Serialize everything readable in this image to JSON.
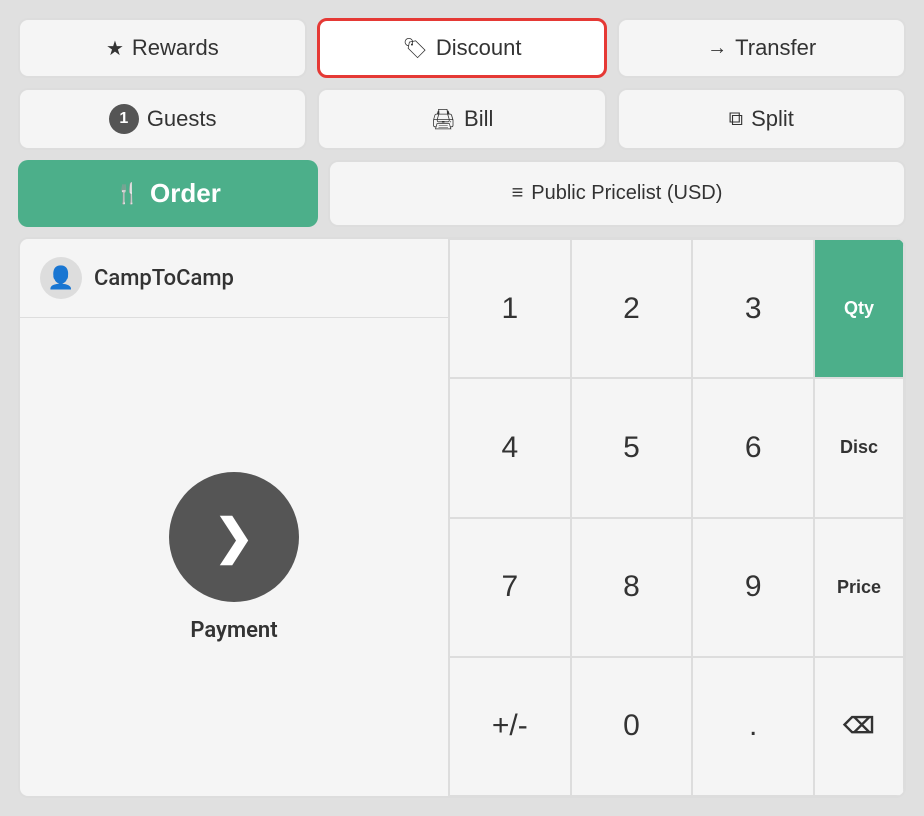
{
  "header": {
    "rewards_label": "Rewards",
    "discount_label": "Discount",
    "transfer_label": "Transfer",
    "guests_count": "1",
    "guests_label": "Guests",
    "bill_label": "Bill",
    "split_label": "Split",
    "order_label": "Order",
    "pricelist_label": "Public Pricelist (USD)"
  },
  "customer": {
    "name": "CampToCamp"
  },
  "payment": {
    "label": "Payment"
  },
  "numpad": {
    "keys": [
      "1",
      "2",
      "3",
      "4",
      "5",
      "6",
      "7",
      "8",
      "9",
      "+/-",
      "0",
      "."
    ],
    "side_keys": [
      "Qty",
      "Disc",
      "Price",
      "⌫"
    ]
  },
  "icons": {
    "rewards": "★",
    "discount": "🏷",
    "transfer": "→",
    "bill": "🖨",
    "split": "⧉",
    "order": "🍴",
    "pricelist": "≡",
    "customer": "👤",
    "chevron_right": "❯"
  },
  "colors": {
    "green": "#4caf8a",
    "dark_badge": "#555555",
    "active_border": "#e53935",
    "bg": "#e0e0e0",
    "btn_bg": "#f5f5f5"
  }
}
